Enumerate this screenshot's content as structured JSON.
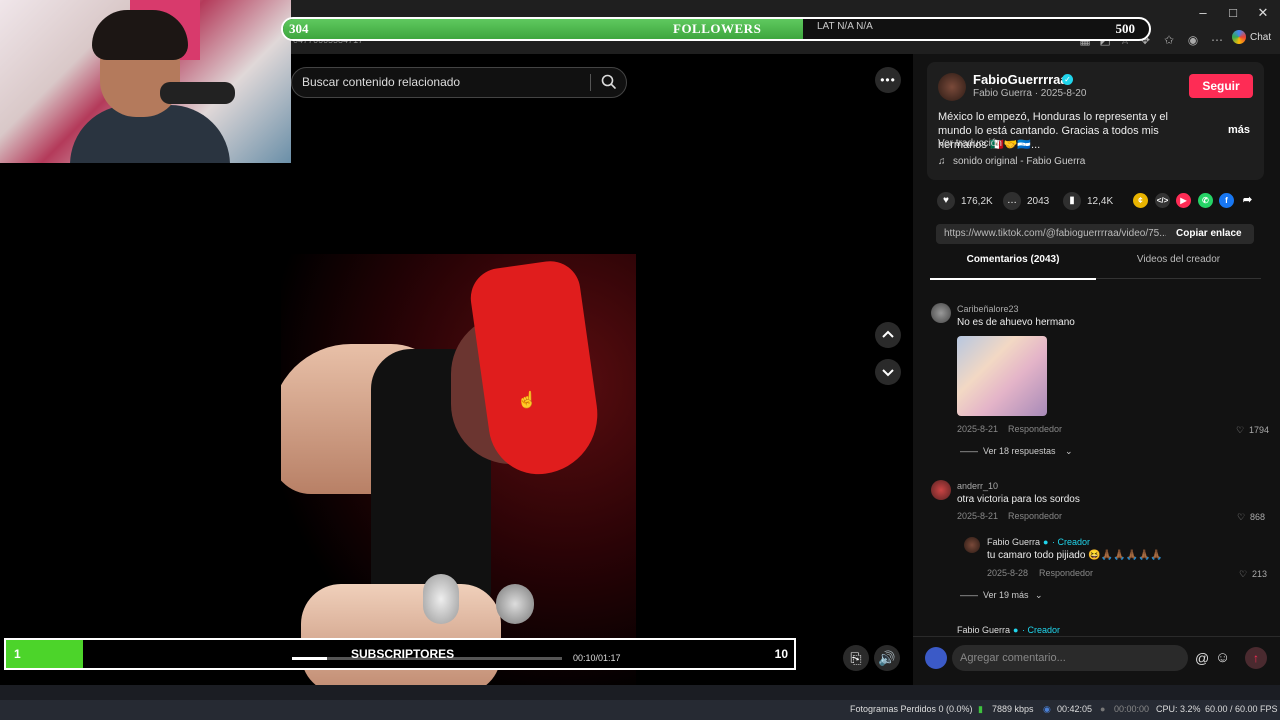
{
  "browser": {
    "url_fragment": "04776665584717",
    "chat_label": "Chat"
  },
  "followers_overlay": {
    "current": "304",
    "label": "FOLLOWERS",
    "extra": "LAT N/A N/A",
    "goal": "500",
    "progress": 0.6
  },
  "search": {
    "placeholder": "Buscar contenido relacionado"
  },
  "post": {
    "author": "FabioGuerrrraa",
    "meta": "Fabio Guerra · 2025-8-20",
    "follow_label": "Seguir",
    "description": "México lo empezó, Honduras lo representa y el mundo lo está cantando. Gracias a todos mis hermanos 🇲🇽🤝🇭🇳...",
    "more_label": "más",
    "translate_label": "Ver traducción",
    "sound": "sonido original - Fabio Guerra"
  },
  "stats": {
    "likes": "176,2K",
    "comments": "2043",
    "saves": "12,4K"
  },
  "link": {
    "url": "https://www.tiktok.com/@fabioguerrrraa/video/75...",
    "copy_label": "Copiar enlace"
  },
  "tabs": {
    "comments": "Comentarios (2043)",
    "videos": "Videos del creador"
  },
  "comments": [
    {
      "user": "Caribeñalore23",
      "text": "No es de ahuevo hermano",
      "date": "2025-8-21",
      "reply": "Respondedor",
      "likes": "1794",
      "replies_label": "Ver 18 respuestas"
    },
    {
      "user": "anderr_10",
      "text": "otra victoria para los sordos",
      "date": "2025-8-21",
      "reply": "Respondedor",
      "likes": "868"
    }
  ],
  "creator_reply": {
    "user": "Fabio Guerra",
    "creator_label": "· Creador",
    "text": "tu camaro todo pijiado 😆🙏🏾🙏🏾🙏🏾🙏🏾🙏🏾",
    "date": "2025-8-28",
    "reply": "Respondedor",
    "likes": "213",
    "more_label": "Ver 19 más"
  },
  "next_comment_user": "Fabio Guerra",
  "comment_input": {
    "placeholder": "Agregar comentario..."
  },
  "subscribers_overlay": {
    "current": "1",
    "label": "SUBSCRIPTORES",
    "goal": "10",
    "progress": 0.1
  },
  "video": {
    "time": "00:10/01:17",
    "progress": 0.13
  },
  "status_bar": {
    "dropped": "Fotogramas Perdidos 0 (0.0%)",
    "bitrate": "7889 kbps",
    "stream_time": "00:42:05",
    "rec_time": "00:00:00",
    "cpu": "CPU: 3.2%",
    "fps": "60.00 / 60.00 FPS"
  },
  "colors": {
    "accent": "#fe2c55",
    "followers_fill": "#4caf50",
    "subs_fill": "#4cd42a",
    "verified": "#20d5ec"
  }
}
